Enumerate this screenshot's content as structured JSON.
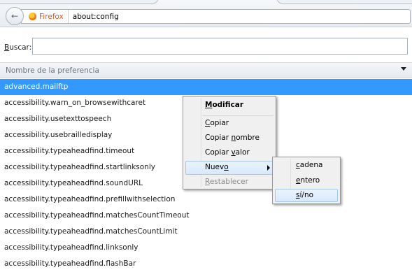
{
  "toolbar": {
    "identity_label": "Firefox",
    "url": "about:config"
  },
  "search": {
    "label_pre": "",
    "label_access": "B",
    "label_post": "uscar:",
    "value": "",
    "placeholder": ""
  },
  "table": {
    "column_header": "Nombre de la preferencia",
    "rows": [
      "advanced.mailftp",
      "accessibility.warn_on_browsewithcaret",
      "accessibility.usetexttospeech",
      "accessibility.usebrailledisplay",
      "accessibility.typeaheadfind.timeout",
      "accessibility.typeaheadfind.startlinksonly",
      "accessibility.typeaheadfind.soundURL",
      "accessibility.typeaheadfind.prefillwithselection",
      "accessibility.typeaheadfind.matchesCountTimeout",
      "accessibility.typeaheadfind.matchesCountLimit",
      "accessibility.typeaheadfind.linksonly",
      "accessibility.typeaheadfind.flashBar"
    ],
    "selected_index": 0
  },
  "context_menu": {
    "modificar": {
      "pre": "",
      "key": "M",
      "post": "odificar"
    },
    "copiar": {
      "pre": "",
      "key": "C",
      "post": "opiar"
    },
    "copiar_nombre": {
      "pre": "Copiar ",
      "key": "n",
      "post": "ombre"
    },
    "copiar_valor": {
      "pre": "Copiar ",
      "key": "v",
      "post": "alor"
    },
    "nuevo": {
      "pre": "Nuev",
      "key": "o",
      "post": ""
    },
    "restablecer": {
      "pre": "",
      "key": "R",
      "post": "establecer"
    }
  },
  "submenu": {
    "cadena": {
      "pre": "",
      "key": "c",
      "post": "adena"
    },
    "entero": {
      "pre": "",
      "key": "e",
      "post": "ntero"
    },
    "sino": {
      "pre": "",
      "key": "s",
      "post": "í/no"
    }
  },
  "icons": {
    "back": "back-arrow-icon",
    "identity": "firefox-icon",
    "column_picker": "chevron-down-icon",
    "submenu_arrow": "chevron-right-icon"
  },
  "colors": {
    "selection": "#3399ff",
    "identity_text": "#e0561b"
  }
}
